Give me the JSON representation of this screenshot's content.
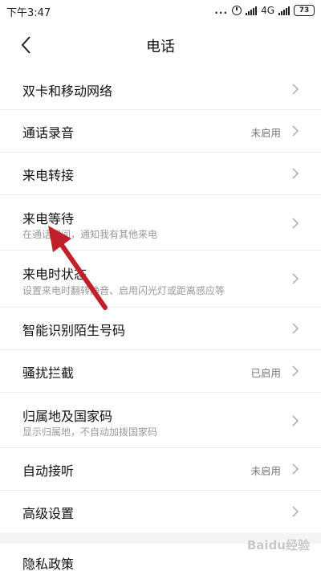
{
  "status_bar": {
    "time": "下午3:47",
    "dots": "...",
    "network": "4G",
    "battery": "73"
  },
  "header": {
    "title": "电话",
    "back_icon": "chevron-left-icon"
  },
  "items": [
    {
      "label": "双卡和移动网络",
      "sub": "",
      "status": ""
    },
    {
      "label": "通话录音",
      "sub": "",
      "status": "未启用"
    },
    {
      "label": "来电转接",
      "sub": "",
      "status": ""
    },
    {
      "label": "来电等待",
      "sub": "在通话期间，通知我有其他来电",
      "status": ""
    },
    {
      "label": "来电时状态",
      "sub": "设置来电时翻转静音、启用闪光灯或距离感应等",
      "status": ""
    },
    {
      "label": "智能识别陌生号码",
      "sub": "",
      "status": ""
    },
    {
      "label": "骚扰拦截",
      "sub": "",
      "status": "已启用"
    },
    {
      "label": "归属地及国家码",
      "sub": "显示归属地，不自动加拨国家码",
      "status": ""
    },
    {
      "label": "自动接听",
      "sub": "",
      "status": "未启用"
    },
    {
      "label": "高级设置",
      "sub": "",
      "status": ""
    },
    {
      "label": "隐私政策",
      "sub": "",
      "status": ""
    }
  ],
  "annotation": {
    "color": "#c0202a",
    "icon": "arrow-annotation-icon"
  },
  "watermark": "Baidu经验"
}
